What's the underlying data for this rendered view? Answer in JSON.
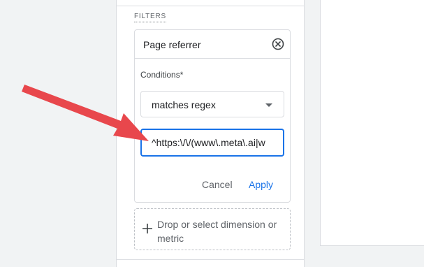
{
  "filters": {
    "section_label": "FILTERS",
    "card": {
      "title": "Page referrer",
      "remove_icon": "close-circle-icon",
      "conditions_label": "Conditions*",
      "operator": "matches regex",
      "value": "^https:\\/\\/(www\\.meta\\.ai|w",
      "cancel_label": "Cancel",
      "apply_label": "Apply"
    },
    "add_item": {
      "icon": "plus-icon",
      "label": "Drop or select dimension or metric"
    }
  },
  "annotation": {
    "icon": "red-arrow-icon",
    "color": "#e8474c"
  },
  "colors": {
    "accent": "#1a73e8",
    "border": "#dadce0"
  }
}
